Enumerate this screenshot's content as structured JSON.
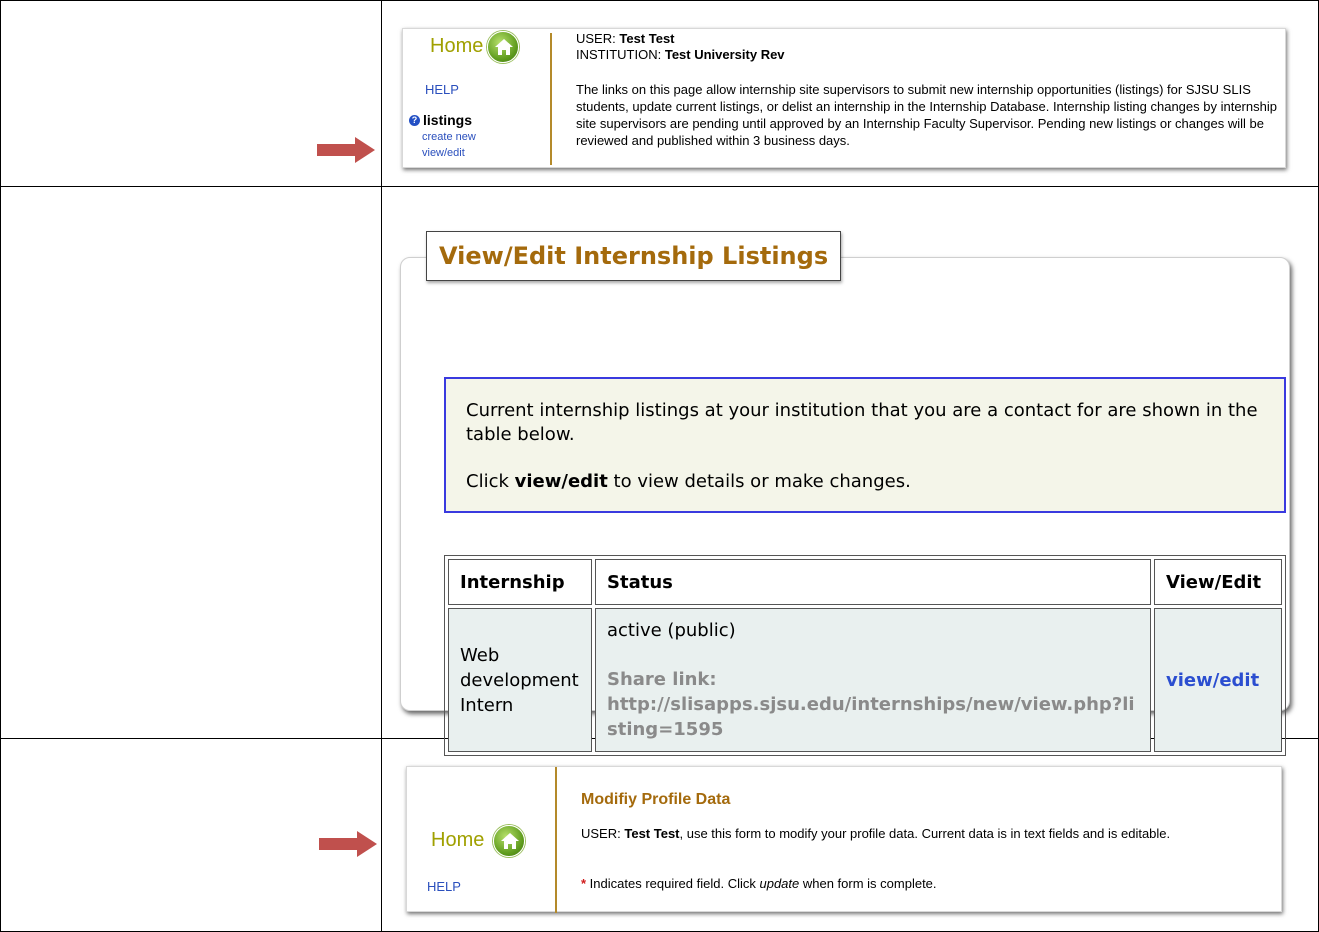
{
  "row1": {
    "home_label": "Home",
    "help_label": "HELP",
    "info_glyph": "?",
    "listings_label": "listings",
    "create_new_label": "create new",
    "view_edit_label": "view/edit",
    "user_key": "USER:",
    "user_value": "Test Test",
    "institution_key": "INSTITUTION:",
    "institution_value": "Test University Rev",
    "description": "The links on this page allow internship site supervisors to submit new internship opportunities (listings) for SJSU SLIS students, update current listings, or delist an internship in the Internship Database. Internship listing changes by internship site supervisors are pending until approved by an Internship Faculty Supervisor. Pending new listings or changes will be reviewed and published within 3 business days."
  },
  "row2": {
    "panel_title": "View/Edit Internship Listings",
    "notice_line1": "Current internship listings at your institution that you are a contact for are shown in the table below.",
    "notice_line2_pre": "Click ",
    "notice_line2_bold": "view/edit",
    "notice_line2_post": " to view details or make changes.",
    "table": {
      "headers": [
        "Internship",
        "Status",
        "View/Edit"
      ],
      "rows": [
        {
          "internship": "Web development Intern",
          "status": "active (public)",
          "share_label": "Share link:",
          "share_url": "http://slisapps.sjsu.edu/internships/new/view.php?listing=1595",
          "action": "view/edit"
        }
      ]
    }
  },
  "row3": {
    "home_label": "Home",
    "help_label": "HELP",
    "title": "Modifiy Profile Data",
    "user_key": "USER:",
    "user_value": "Test Test",
    "user_text": ", use this form to modify your profile data. Current data is in text fields and is editable.",
    "required_star": "*",
    "required_pre": " Indicates required field. Click ",
    "required_em": "update",
    "required_post": " when form is complete."
  },
  "colors": {
    "arrow": "#c0504d",
    "accent_gold": "#a46a0c",
    "link_blue": "#2b4ed0",
    "notice_border": "#3a3adf",
    "notice_bg": "#f4f5e9",
    "cell_bg": "#e9f0ef"
  },
  "icons": [
    "arrow-right-icon",
    "home-icon",
    "info-icon"
  ]
}
